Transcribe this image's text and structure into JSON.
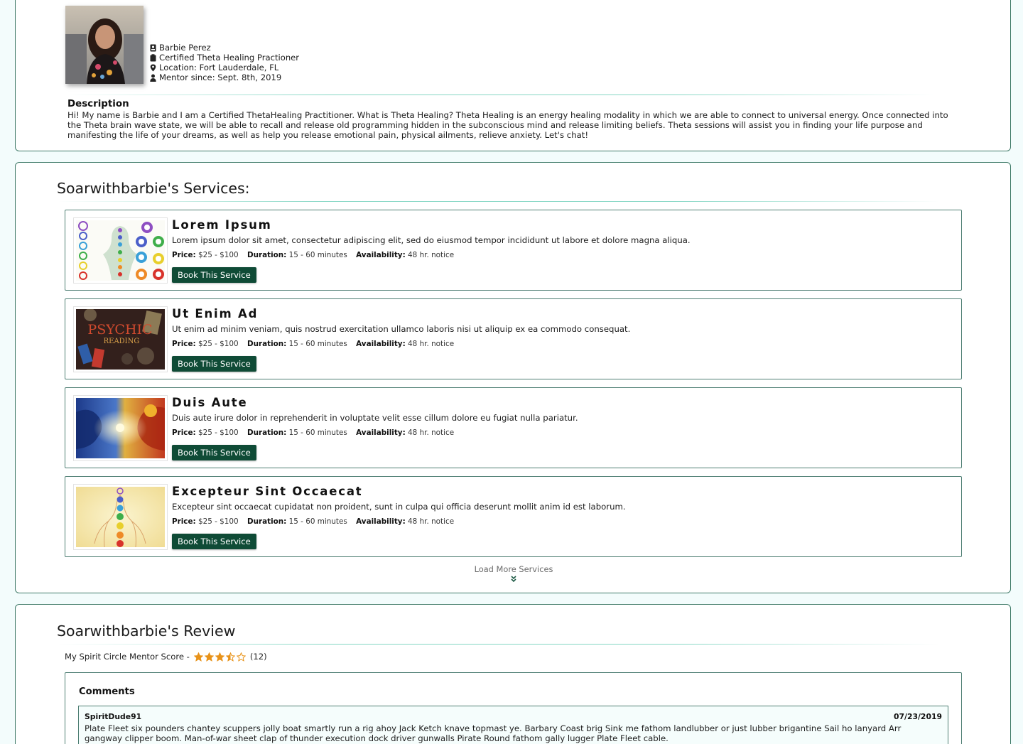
{
  "profile": {
    "name": "Barbie Perez",
    "certification": "Certified Theta Healing Practioner",
    "location": "Location: Fort Lauderdale, FL",
    "mentor_since": "Mentor since: Sept. 8th, 2019",
    "description_title": "Description",
    "description": "Hi! My name is Barbie and I am a Certified ThetaHealing Practitioner. What is Theta Healing? Theta Healing is an energy healing modality in which we are able to connect to universal energy. Once connected into the Theta brain wave state, we will be able to recall and release old programming hidden in the subconscious mind and release limiting beliefs. Theta sessions will assist you in finding your life purpose and manifesting the life of your dreams, as well as help you release emotional pain, physical ailments, relieve anxiety. Let's chat!"
  },
  "services": {
    "title": "Soarwithbarbie's Services:",
    "labels": {
      "price": "Price:",
      "duration": "Duration:",
      "availability": "Availability:",
      "book": "Book This Service"
    },
    "items": [
      {
        "title": "Lorem Ipsum",
        "description": "Lorem ipsum dolor sit amet, consectetur adipiscing elit, sed do eiusmod tempor incididunt ut labore et dolore magna aliqua.",
        "price": "$25 - $100",
        "duration": "15 - 60 minutes",
        "availability": "48 hr. notice",
        "image": "chakra-symbols-image"
      },
      {
        "title": "Ut Enim Ad",
        "description": "Ut enim ad minim veniam, quis nostrud exercitation ullamco laboris nisi ut aliquip ex ea commodo consequat.",
        "price": "$25 - $100",
        "duration": "15 - 60 minutes",
        "availability": "48 hr. notice",
        "image": "psychic-reading-image",
        "image_text": [
          "PSYCHIC",
          "READING"
        ]
      },
      {
        "title": "Duis Aute",
        "description": "Duis aute irure dolor in reprehenderit in voluptate velit esse cillum dolore eu fugiat nulla pariatur.",
        "price": "$25 - $100",
        "duration": "15 - 60 minutes",
        "availability": "48 hr. notice",
        "image": "cosmic-faces-image"
      },
      {
        "title": "Excepteur Sint Occaecat",
        "description": "Excepteur sint occaecat cupidatat non proident, sunt in culpa qui officia deserunt mollit anim id est laborum.",
        "price": "$25 - $100",
        "duration": "15 - 60 minutes",
        "availability": "48 hr. notice",
        "image": "chakra-body-image"
      }
    ],
    "load_more": "Load More Services"
  },
  "review": {
    "title": "Soarwithbarbie's Review",
    "score_label": "My Spirit Circle Mentor Score -",
    "rating": 3.5,
    "rating_max": 5,
    "count": "(12)",
    "comments_title": "Comments",
    "comments": [
      {
        "author": "SpiritDude91",
        "date": "07/23/2019",
        "text": "Plate Fleet six pounders chantey scuppers jolly boat smartly run a rig ahoy Jack Ketch knave topmast ye. Barbary Coast brig Sink me fathom landlubber or just lubber brigantine Sail ho lanyard Arr gangway clipper boom. Man-of-war sheet clap of thunder execution dock driver gunwalls Pirate Round fathom gally lugger Plate Fleet cable."
      }
    ]
  },
  "colors": {
    "accent": "#0f4b36",
    "border": "#3f7a68",
    "star": "#e8931a",
    "page_bg": "#f3fcfc"
  }
}
